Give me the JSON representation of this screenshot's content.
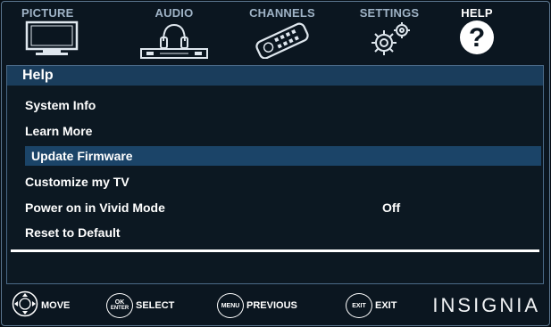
{
  "tabs": [
    {
      "label": "PICTURE",
      "icon": "tv-icon"
    },
    {
      "label": "AUDIO",
      "icon": "headphones-speaker-icon"
    },
    {
      "label": "CHANNELS",
      "icon": "remote-control-icon"
    },
    {
      "label": "SETTINGS",
      "icon": "gears-icon"
    },
    {
      "label": "HELP",
      "icon": "question-mark-icon",
      "active": true
    }
  ],
  "panel": {
    "title": "Help",
    "items": [
      {
        "label": "System Info",
        "value": ""
      },
      {
        "label": "Learn More",
        "value": ""
      },
      {
        "label": "Update Firmware",
        "value": "",
        "selected": true
      },
      {
        "label": "Customize my TV",
        "value": ""
      },
      {
        "label": "Power on in Vivid Mode",
        "value": "Off"
      },
      {
        "label": "Reset to Default",
        "value": ""
      }
    ]
  },
  "footer": {
    "move": {
      "label": "MOVE"
    },
    "select": {
      "button_top": "OK",
      "button_bottom": "ENTER",
      "label": "SELECT"
    },
    "previous": {
      "button": "MENU",
      "label": "PREVIOUS"
    },
    "exit": {
      "button": "EXIT",
      "label": "EXIT"
    },
    "brand": "INSIGNIA"
  },
  "colors": {
    "background": "#0b1620",
    "title_bar": "#1a3d5c",
    "selected_row": "#1b4468",
    "inactive_tab_text": "#9fb3c6"
  }
}
